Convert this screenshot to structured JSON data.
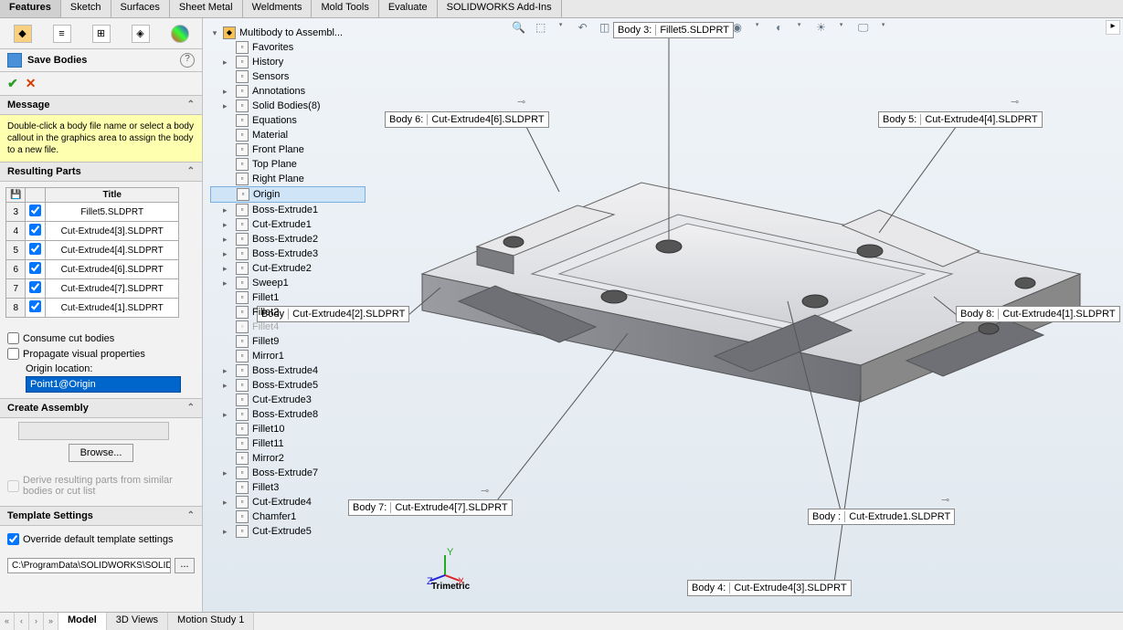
{
  "topTabs": [
    "Features",
    "Sketch",
    "Surfaces",
    "Sheet Metal",
    "Weldments",
    "Mold Tools",
    "Evaluate",
    "SOLIDWORKS Add-Ins"
  ],
  "activeTopTab": "Features",
  "propPanel": {
    "title": "Save Bodies",
    "messageHeader": "Message",
    "messageBody": "Double-click a body file name or select a body callout in the graphics area to assign the body to a new file.",
    "resultingPartsHeader": "Resulting Parts",
    "titleCol": "Title",
    "rows": [
      {
        "n": "3",
        "title": "Fillet5.SLDPRT",
        "chk": true
      },
      {
        "n": "4",
        "title": "Cut-Extrude4[3].SLDPRT",
        "chk": true
      },
      {
        "n": "5",
        "title": "Cut-Extrude4[4].SLDPRT",
        "chk": true
      },
      {
        "n": "6",
        "title": "Cut-Extrude4[6].SLDPRT",
        "chk": true
      },
      {
        "n": "7",
        "title": "Cut-Extrude4[7].SLDPRT",
        "chk": true
      },
      {
        "n": "8",
        "title": "Cut-Extrude4[1].SLDPRT",
        "chk": true
      }
    ],
    "consumeCut": "Consume cut bodies",
    "propagate": "Propagate visual properties",
    "originLabel": "Origin location:",
    "originValue": "Point1@Origin",
    "createAssembly": "Create Assembly",
    "browse": "Browse...",
    "derive": "Derive resulting parts from similar bodies or cut list",
    "templateSettings": "Template Settings",
    "overrideTempl": "Override default template settings",
    "templPath": "C:\\ProgramData\\SOLIDWORKS\\SOLID"
  },
  "ftree": {
    "root": "Multibody to Assembl...",
    "items": [
      {
        "label": "Favorites",
        "exp": false
      },
      {
        "label": "History",
        "exp": true
      },
      {
        "label": "Sensors",
        "exp": false
      },
      {
        "label": "Annotations",
        "exp": true
      },
      {
        "label": "Solid Bodies(8)",
        "exp": true
      },
      {
        "label": "Equations",
        "exp": false
      },
      {
        "label": "Material <not spe...",
        "exp": false
      },
      {
        "label": "Front Plane",
        "exp": false
      },
      {
        "label": "Top Plane",
        "exp": false
      },
      {
        "label": "Right Plane",
        "exp": false
      },
      {
        "label": "Origin",
        "exp": false,
        "sel": true
      },
      {
        "label": "Boss-Extrude1",
        "exp": true
      },
      {
        "label": "Cut-Extrude1",
        "exp": true
      },
      {
        "label": "Boss-Extrude2",
        "exp": true
      },
      {
        "label": "Boss-Extrude3",
        "exp": true
      },
      {
        "label": "Cut-Extrude2",
        "exp": true
      },
      {
        "label": "Sweep1",
        "exp": true
      },
      {
        "label": "Fillet1",
        "exp": false
      },
      {
        "label": "Fillet2",
        "exp": false
      },
      {
        "label": "Fillet4",
        "exp": false,
        "dim": true
      },
      {
        "label": "Fillet9",
        "exp": false
      },
      {
        "label": "Mirror1",
        "exp": false
      },
      {
        "label": "Boss-Extrude4",
        "exp": true
      },
      {
        "label": "Boss-Extrude5",
        "exp": true
      },
      {
        "label": "Cut-Extrude3",
        "exp": false
      },
      {
        "label": "Boss-Extrude8",
        "exp": true
      },
      {
        "label": "Fillet10",
        "exp": false
      },
      {
        "label": "Fillet11",
        "exp": false
      },
      {
        "label": "Mirror2",
        "exp": false
      },
      {
        "label": "Boss-Extrude7",
        "exp": true
      },
      {
        "label": "Fillet3",
        "exp": false
      },
      {
        "label": "Cut-Extrude4",
        "exp": true
      },
      {
        "label": "Chamfer1",
        "exp": false
      },
      {
        "label": "Cut-Extrude5",
        "exp": true
      }
    ]
  },
  "callouts": {
    "b3": {
      "lab": "Body  3:",
      "val": "Fillet5.SLDPRT"
    },
    "b5": {
      "lab": "Body  5:",
      "val": "Cut-Extrude4[4].SLDPRT"
    },
    "b6": {
      "lab": "Body  6:",
      "val": "Cut-Extrude4[6].SLDPRT"
    },
    "b8": {
      "lab": "Body  8:",
      "val": "Cut-Extrude4[1].SLDPRT"
    },
    "bd": {
      "lab": "Body",
      "val": "Cut-Extrude4[2].SLDPRT"
    },
    "b7": {
      "lab": "Body  7:",
      "val": "Cut-Extrude4[7].SLDPRT"
    },
    "bc": {
      "lab": "Body   :",
      "val": "Cut-Extrude1.SLDPRT"
    },
    "b4": {
      "lab": "Body  4:",
      "val": "Cut-Extrude4[3].SLDPRT"
    }
  },
  "btmTabs": [
    "Model",
    "3D Views",
    "Motion Study 1"
  ],
  "activeBtmTab": "Model",
  "triadLabel": "Trimetric"
}
